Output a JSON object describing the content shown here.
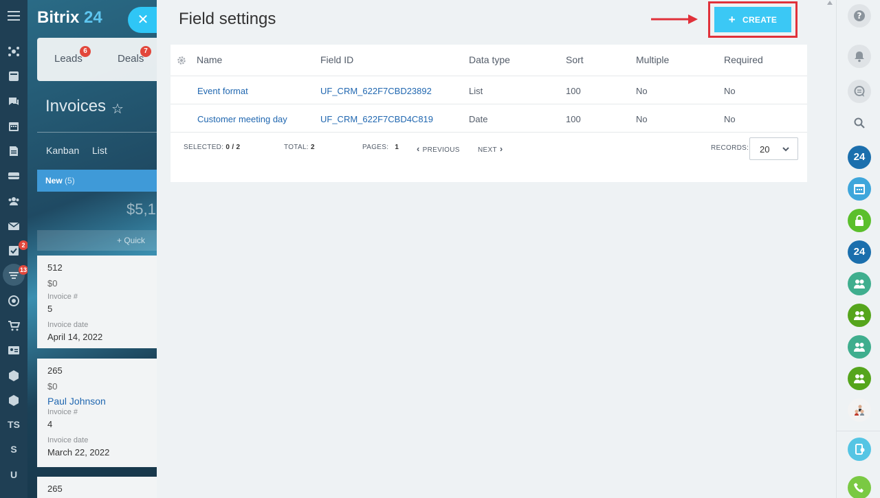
{
  "app": {
    "logo_text": "Bitrix",
    "logo_num": "24"
  },
  "left_sidebar": {
    "items": [
      {
        "icon": "activity-stream-icon"
      },
      {
        "icon": "feed-icon"
      },
      {
        "icon": "chat-icon"
      },
      {
        "icon": "calendar-icon"
      },
      {
        "icon": "documents-icon"
      },
      {
        "icon": "drive-icon"
      },
      {
        "icon": "contacts-icon"
      },
      {
        "icon": "mail-icon"
      },
      {
        "icon": "tasks-icon",
        "badge": "2"
      },
      {
        "icon": "crm-funnel-icon",
        "badge": "13"
      },
      {
        "icon": "target-icon"
      },
      {
        "icon": "cart-icon"
      },
      {
        "icon": "contact-card-icon"
      },
      {
        "icon": "box-icon"
      },
      {
        "icon": "box-icon-2"
      }
    ],
    "text_items": [
      "TS",
      "S",
      "U"
    ]
  },
  "crm": {
    "tabs": [
      {
        "label": "Leads",
        "badge": "6"
      },
      {
        "label": "Deals",
        "badge": "7"
      }
    ],
    "title": "Invoices",
    "views": [
      "Kanban",
      "List"
    ],
    "stage": {
      "label": "New",
      "count": "(5)"
    },
    "stage_sum": "$5,1",
    "quick_label": "+ Quick",
    "cards": [
      {
        "title": "512",
        "amount": "$0",
        "link": "",
        "f1_label": "Invoice #",
        "f1_value": "5",
        "f2_label": "Invoice date",
        "f2_value": "April 14, 2022"
      },
      {
        "title": "265",
        "amount": "$0",
        "link": "Paul Johnson",
        "f1_label": "Invoice #",
        "f1_value": "4",
        "f2_label": "Invoice date",
        "f2_value": "March 22, 2022"
      },
      {
        "title": "265"
      }
    ]
  },
  "panel": {
    "title": "Field settings",
    "create_label": "CREATE",
    "columns": [
      "Name",
      "Field ID",
      "Data type",
      "Sort",
      "Multiple",
      "Required"
    ],
    "rows": [
      {
        "name": "Event format",
        "field_id": "UF_CRM_622F7CBD23892",
        "data_type": "List",
        "sort": "100",
        "multiple": "No",
        "required": "No"
      },
      {
        "name": "Customer meeting day",
        "field_id": "UF_CRM_622F7CBD4C819",
        "data_type": "Date",
        "sort": "100",
        "multiple": "No",
        "required": "No"
      }
    ],
    "footer": {
      "selected_label": "SELECTED:",
      "selected_value": "0 / 2",
      "total_label": "TOTAL:",
      "total_value": "2",
      "pages_label": "PAGES:",
      "pages_value": "1",
      "prev_label": "PREVIOUS",
      "next_label": "NEXT",
      "records_label": "RECORDS:",
      "records_value": "20"
    }
  },
  "right_bar": {
    "items": [
      {
        "icon": "help-icon"
      },
      {
        "icon": "bell-icon"
      },
      {
        "icon": "chat-bubble-icon"
      },
      {
        "icon": "search-icon"
      }
    ],
    "avatars": [
      {
        "text": "24",
        "color": "#1b6fad"
      },
      {
        "text": "",
        "color": "#3ea6db",
        "icon": "calendar-icon"
      },
      {
        "text": "",
        "color": "#5bbf2c",
        "icon": "lock-icon"
      },
      {
        "text": "24",
        "color": "#1b6fad"
      },
      {
        "text": "",
        "color": "#3fae8e",
        "icon": "group-icon"
      },
      {
        "text": "",
        "color": "#55a51c",
        "icon": "group-icon"
      },
      {
        "text": "",
        "color": "#3fae8e",
        "icon": "group-icon"
      },
      {
        "text": "",
        "color": "#55a51c",
        "icon": "group-icon"
      }
    ]
  }
}
